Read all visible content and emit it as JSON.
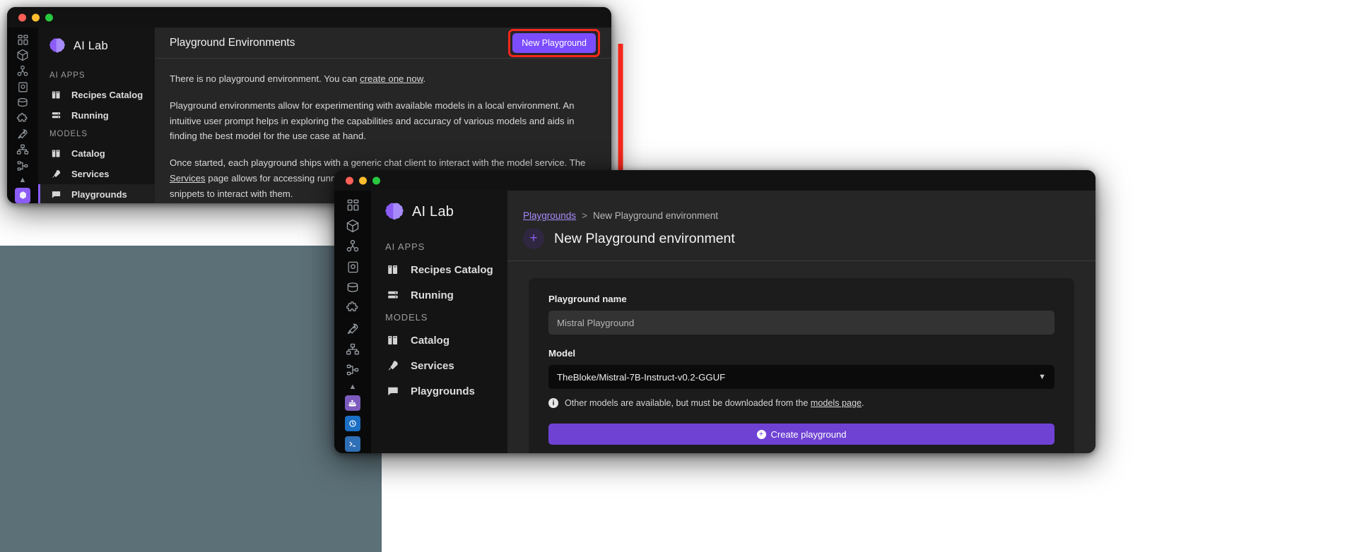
{
  "app": {
    "brand_name": "AI Lab",
    "brand_icon": "brain-icon"
  },
  "rail": {
    "items": [
      {
        "icon": "dashboard-icon",
        "selected": false
      },
      {
        "icon": "cube-icon",
        "selected": false
      },
      {
        "icon": "pods-icon",
        "selected": false
      },
      {
        "icon": "image-icon",
        "selected": false
      },
      {
        "icon": "volume-icon",
        "selected": false
      },
      {
        "icon": "extensions-icon",
        "selected": false
      },
      {
        "icon": "rocket-icon",
        "selected": true
      },
      {
        "icon": "kubernetes-icon",
        "selected": false
      },
      {
        "icon": "compose-icon",
        "selected": false
      }
    ],
    "collapse_icon": "chevron-up-icon",
    "bottom_icons": [
      "docker-icon",
      "podman-icon",
      "terminal-icon"
    ]
  },
  "sidebar": {
    "groups": [
      {
        "title": "AI APPS",
        "items": [
          {
            "label": "Recipes Catalog",
            "icon": "book-icon",
            "active": false
          },
          {
            "label": "Running",
            "icon": "server-icon",
            "active": false
          }
        ]
      },
      {
        "title": "MODELS",
        "items": [
          {
            "label": "Catalog",
            "icon": "book-icon",
            "active": false
          },
          {
            "label": "Services",
            "icon": "rocket-icon",
            "active": false
          },
          {
            "label": "Playgrounds",
            "icon": "chat-icon",
            "active": true
          }
        ]
      }
    ]
  },
  "window1": {
    "title": "Playground Environments",
    "new_button": "New Playground",
    "paragraphs": [
      {
        "before": "There is no playground environment. You can ",
        "link": "create one now",
        "after": "."
      },
      {
        "text": "Playground environments allow for experimenting with available models in a local environment. An intuitive user prompt helps in exploring the capabilities and accuracy of various models and aids in finding the best model for the use case at hand."
      },
      {
        "before": "Once started, each playground ships with a generic chat client to interact with the model service. The ",
        "link": "Services",
        "after": " page allows for accessing running model services and provides further details and code snippets to interact with them."
      }
    ]
  },
  "window2": {
    "breadcrumb": {
      "root": "Playgrounds",
      "separator": ">",
      "current": "New Playground environment"
    },
    "page_title": "New Playground environment",
    "plus_icon": "plus-icon",
    "form": {
      "name_label": "Playground name",
      "name_value": "Mistral Playground",
      "model_label": "Model",
      "model_value": "TheBloke/Mistral-7B-Instruct-v0.2-GGUF",
      "model_chevron": "chevron-down-icon",
      "hint_icon": "info-icon",
      "hint_before": "Other models are available, but must be downloaded from the ",
      "hint_link": "models page",
      "hint_after": ".",
      "submit_label": "Create playground"
    }
  },
  "annotation": {
    "arrow_icon": "down-arrow-annotation",
    "arrow_color": "#f4271a",
    "highlight_color": "#f4271a"
  },
  "colors": {
    "accent": "#7c4dff",
    "accent_link": "#a78bfa",
    "button_primary": "#6f42d4",
    "window_bg": "#262626",
    "sidebar_bg": "#141414",
    "rail_bg": "#0a0a0a"
  }
}
